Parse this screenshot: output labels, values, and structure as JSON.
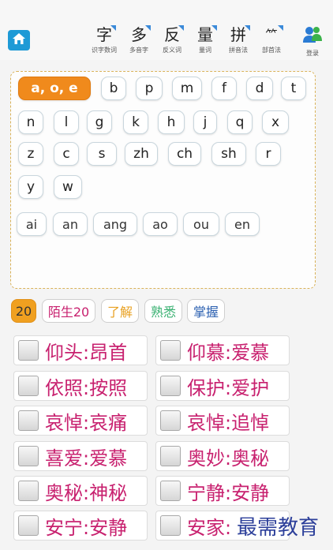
{
  "toolbar": {
    "tools": [
      {
        "glyph": "字",
        "label": "识字数词"
      },
      {
        "glyph": "多",
        "label": "多音字"
      },
      {
        "glyph": "反",
        "label": "反义词"
      },
      {
        "glyph": "量",
        "label": "量词"
      },
      {
        "glyph": "拼",
        "label": "拼音法"
      },
      {
        "glyph": "⺮",
        "label": "部首法"
      }
    ],
    "login_label": "登录"
  },
  "pinyin": {
    "selected": "a, o, e",
    "initials": [
      "b",
      "p",
      "m",
      "f",
      "d",
      "t",
      "n",
      "l",
      "g",
      "k",
      "h",
      "j",
      "q",
      "x",
      "z",
      "c",
      "s",
      "zh",
      "ch",
      "sh",
      "r",
      "y",
      "w"
    ],
    "finals": [
      "ai",
      "an",
      "ang",
      "ao",
      "ou",
      "en"
    ]
  },
  "filters": {
    "count": "20",
    "unknown": "陌生20",
    "understand": "了解",
    "familiar": "熟悉",
    "mastered": "掌握",
    "colors": {
      "unknown": "#c8216f",
      "understand": "#e8a020",
      "familiar": "#3bb273",
      "mastered": "#2a5fb0"
    }
  },
  "words": [
    "仰头:昂首",
    "仰慕:爱慕",
    "依照:按照",
    "保护:爱护",
    "哀悼:哀痛",
    "哀悼:追悼",
    "喜爱:爱慕",
    "奥妙:奥秘",
    "奥秘:神秘",
    "宁静:安静",
    "安宁:安静",
    "安家:"
  ],
  "watermark": "最需教育"
}
